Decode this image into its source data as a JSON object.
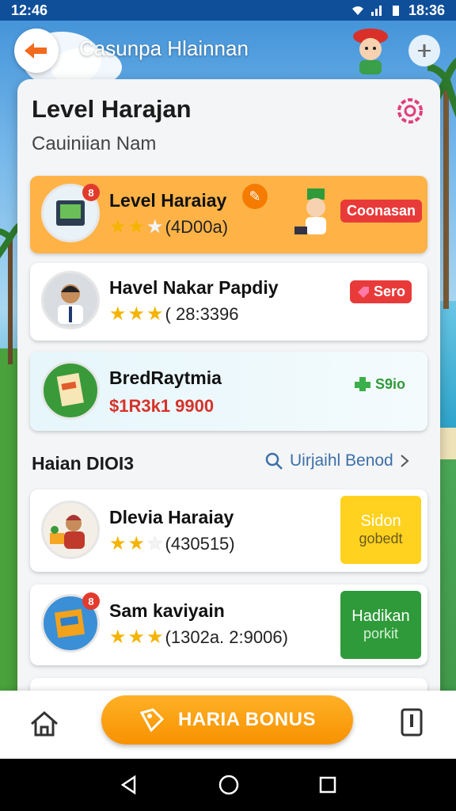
{
  "status_bar": {
    "time_left": "12:46",
    "time_right": "18:36"
  },
  "header": {
    "title": "Casunpa Hlainnan"
  },
  "card": {
    "title": "Level Harajan",
    "subtitle": "Cauiniian Nam"
  },
  "featured": [
    {
      "name": "Level Haraiay",
      "rating_text": "(4D00a)",
      "stars": 3,
      "stars_filled": 2,
      "badge": "8",
      "action": "Coonasan",
      "highlight": true
    },
    {
      "name": "Havel Nakar Papdiy",
      "rating_text": "( 28:3396",
      "stars": 3,
      "stars_filled": 3,
      "action": "Sero"
    },
    {
      "name": "BredRaytmia",
      "price": "$1R3k1 9900",
      "action": "S9io"
    }
  ],
  "section": {
    "title": "Haian DIOI3",
    "link": "Uirjaihl Benod"
  },
  "list": [
    {
      "name": "Dlevia Haraiay",
      "rating_text": "(430515)",
      "stars": 3,
      "stars_filled": 2,
      "btn_top": "Sidon",
      "btn_bottom": "gobedt"
    },
    {
      "name": "Sam kaviyain",
      "rating_text": "(1302a. 2:9006)",
      "stars": 3,
      "stars_filled": 3,
      "badge": "8",
      "btn_top": "Hadikan",
      "btn_bottom": "porkit"
    }
  ],
  "bottom_nav": {
    "bonus_label": "HARIA BONUS"
  },
  "colors": {
    "accent_orange": "#f79200",
    "featured_bg": "#ffb347",
    "green_btn": "#2f9a3a",
    "yellow_btn": "#ffd21f",
    "red_pill": "#e93a3a"
  },
  "icons": [
    "back-icon",
    "info-icon",
    "settings-icon",
    "search-icon",
    "chevron-right-icon",
    "home-icon",
    "bonus-icon",
    "wallet-icon",
    "back-nav-icon",
    "home-nav-icon",
    "recents-nav-icon"
  ]
}
